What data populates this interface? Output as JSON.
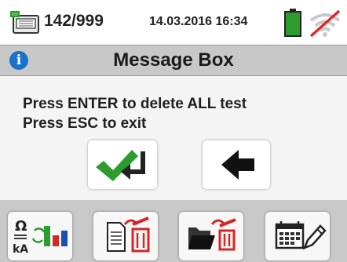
{
  "status": {
    "memory_count": "142/999",
    "datetime": "14.03.2016  16:34",
    "icons": {
      "memory": "memory-card-icon",
      "battery": "battery-full-icon",
      "wifi": "wifi-off-icon"
    }
  },
  "dialog": {
    "title": "Message Box",
    "info_icon": "i",
    "lines": [
      "Press ENTER to delete ALL test",
      "Press ESC to exit"
    ]
  },
  "buttons": {
    "enter": "enter-check-icon",
    "esc": "back-arrow-icon"
  },
  "toolbar": {
    "tools": [
      "measure-chart-icon",
      "delete-test-icon",
      "delete-folder-icon",
      "calendar-edit-icon"
    ],
    "ohm_label": "Ω",
    "ka_label": "kA"
  },
  "colors": {
    "accent_green": "#2e9b2e",
    "delete_red": "#d62626",
    "info_blue": "#1a73c9",
    "header_gray": "#c8c8c8"
  }
}
